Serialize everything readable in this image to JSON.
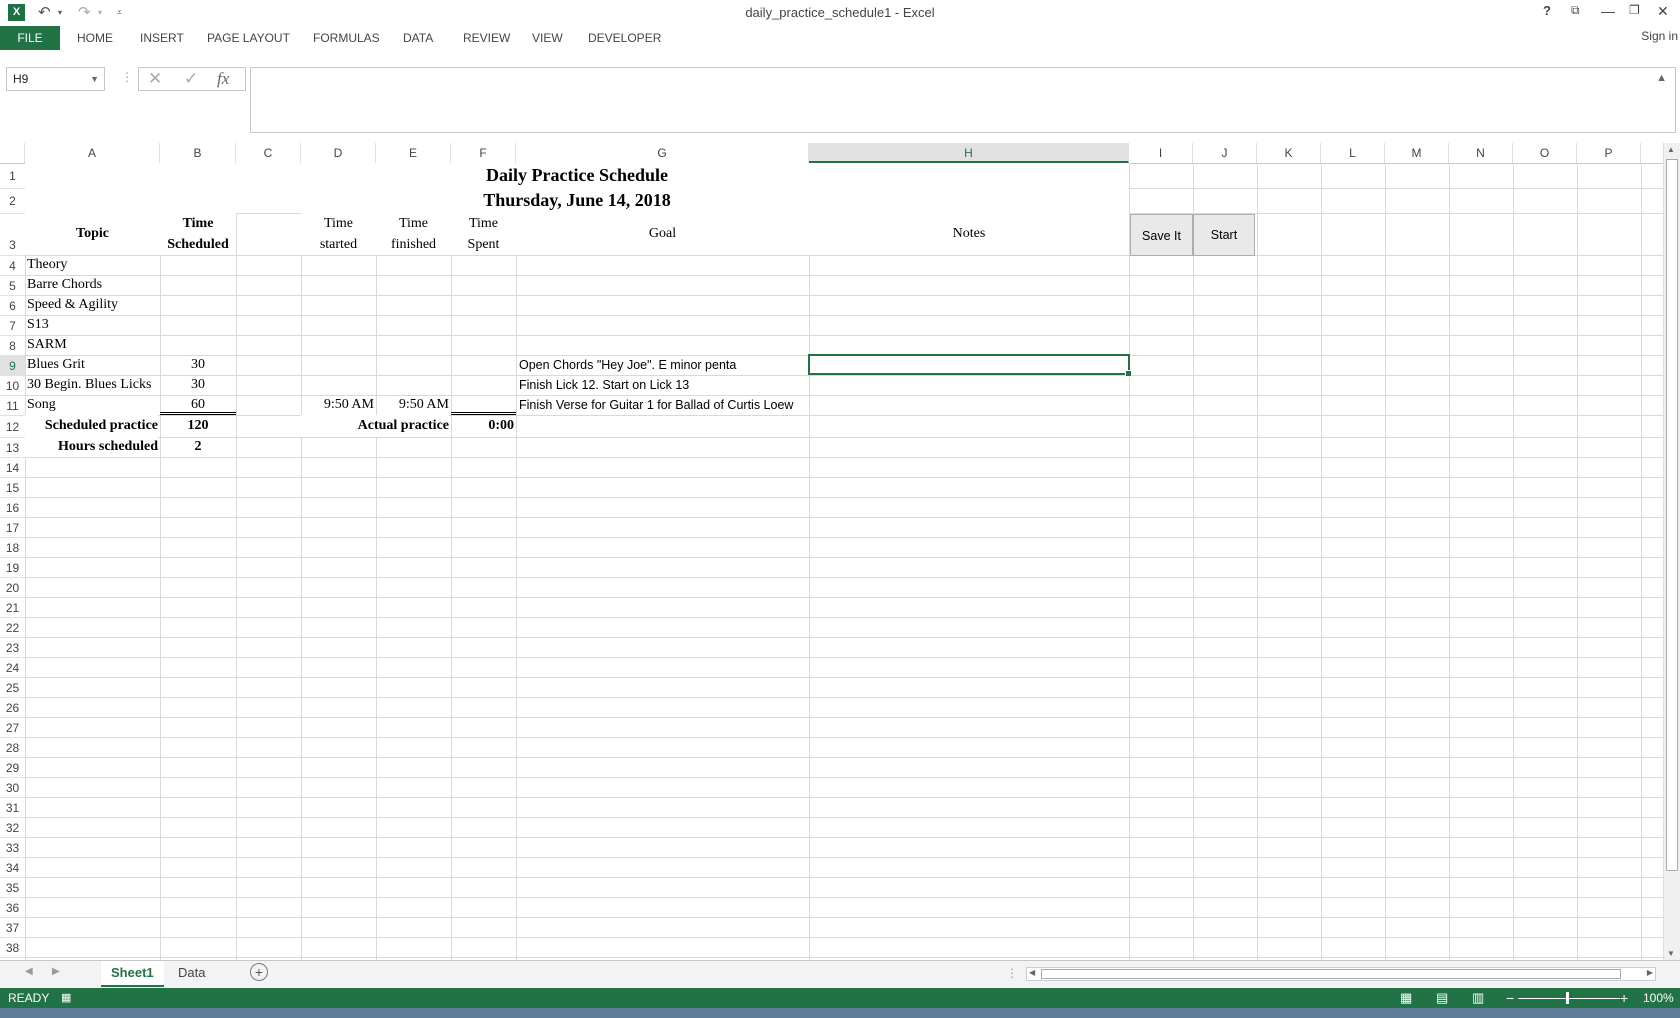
{
  "window": {
    "title": "daily_practice_schedule1 - Excel",
    "sign_in": "Sign in"
  },
  "ribbon": {
    "file": "FILE",
    "tabs": [
      "HOME",
      "INSERT",
      "PAGE LAYOUT",
      "FORMULAS",
      "DATA",
      "REVIEW",
      "VIEW",
      "DEVELOPER"
    ]
  },
  "formula_bar": {
    "name_box": "H9",
    "formula": ""
  },
  "columns": [
    "A",
    "B",
    "C",
    "D",
    "E",
    "F",
    "G",
    "H",
    "I",
    "J",
    "K",
    "L",
    "M",
    "N",
    "O",
    "P"
  ],
  "selected_column": "H",
  "selected_row": "9",
  "rows": [
    "1",
    "2",
    "3",
    "4",
    "5",
    "6",
    "7",
    "8",
    "9",
    "10",
    "11",
    "12",
    "13",
    "14",
    "15",
    "16",
    "17",
    "18",
    "19",
    "20",
    "21",
    "22",
    "23",
    "24",
    "25",
    "26",
    "27",
    "28",
    "29",
    "30",
    "31",
    "32",
    "33",
    "34",
    "35",
    "36",
    "37",
    "38"
  ],
  "sheet": {
    "title": "Daily Practice Schedule",
    "date": "Thursday, June 14, 2018",
    "headers": {
      "topic": "Topic",
      "time_scheduled_1": "Time",
      "time_scheduled_2": "Scheduled",
      "time_started_1": "Time",
      "time_started_2": "started",
      "time_finished_1": "Time",
      "time_finished_2": "finished",
      "time_spent_1": "Time",
      "time_spent_2": "Spent",
      "goal": "Goal",
      "notes": "Notes"
    },
    "topics": [
      {
        "topic": "Theory",
        "scheduled": "",
        "started": "",
        "finished": "",
        "goal": ""
      },
      {
        "topic": "Barre Chords",
        "scheduled": "",
        "started": "",
        "finished": "",
        "goal": ""
      },
      {
        "topic": "Speed & Agility",
        "scheduled": "",
        "started": "",
        "finished": "",
        "goal": ""
      },
      {
        "topic": "S13",
        "scheduled": "",
        "started": "",
        "finished": "",
        "goal": ""
      },
      {
        "topic": "SARM",
        "scheduled": "",
        "started": "",
        "finished": "",
        "goal": ""
      },
      {
        "topic": "Blues Grit",
        "scheduled": "30",
        "started": "",
        "finished": "",
        "goal": "Open Chords \"Hey Joe\".  E minor penta"
      },
      {
        "topic": "30 Begin. Blues Licks",
        "scheduled": "30",
        "started": "",
        "finished": "",
        "goal": "Finish Lick 12.  Start on Lick 13"
      },
      {
        "topic": "Song",
        "scheduled": "60",
        "started": "9:50 AM",
        "finished": "9:50 AM",
        "goal": "Finish Verse for Guitar 1 for Ballad of Curtis Loew"
      }
    ],
    "summary": {
      "scheduled_label": "Scheduled practice",
      "scheduled_value": "120",
      "actual_label": "Actual practice",
      "actual_value": "0:00",
      "hours_label": "Hours scheduled",
      "hours_value": "2"
    },
    "buttons": {
      "save": "Save It",
      "start": "Start"
    }
  },
  "sheet_tabs": [
    "Sheet1",
    "Data"
  ],
  "status": {
    "mode": "READY",
    "zoom": "100%"
  }
}
